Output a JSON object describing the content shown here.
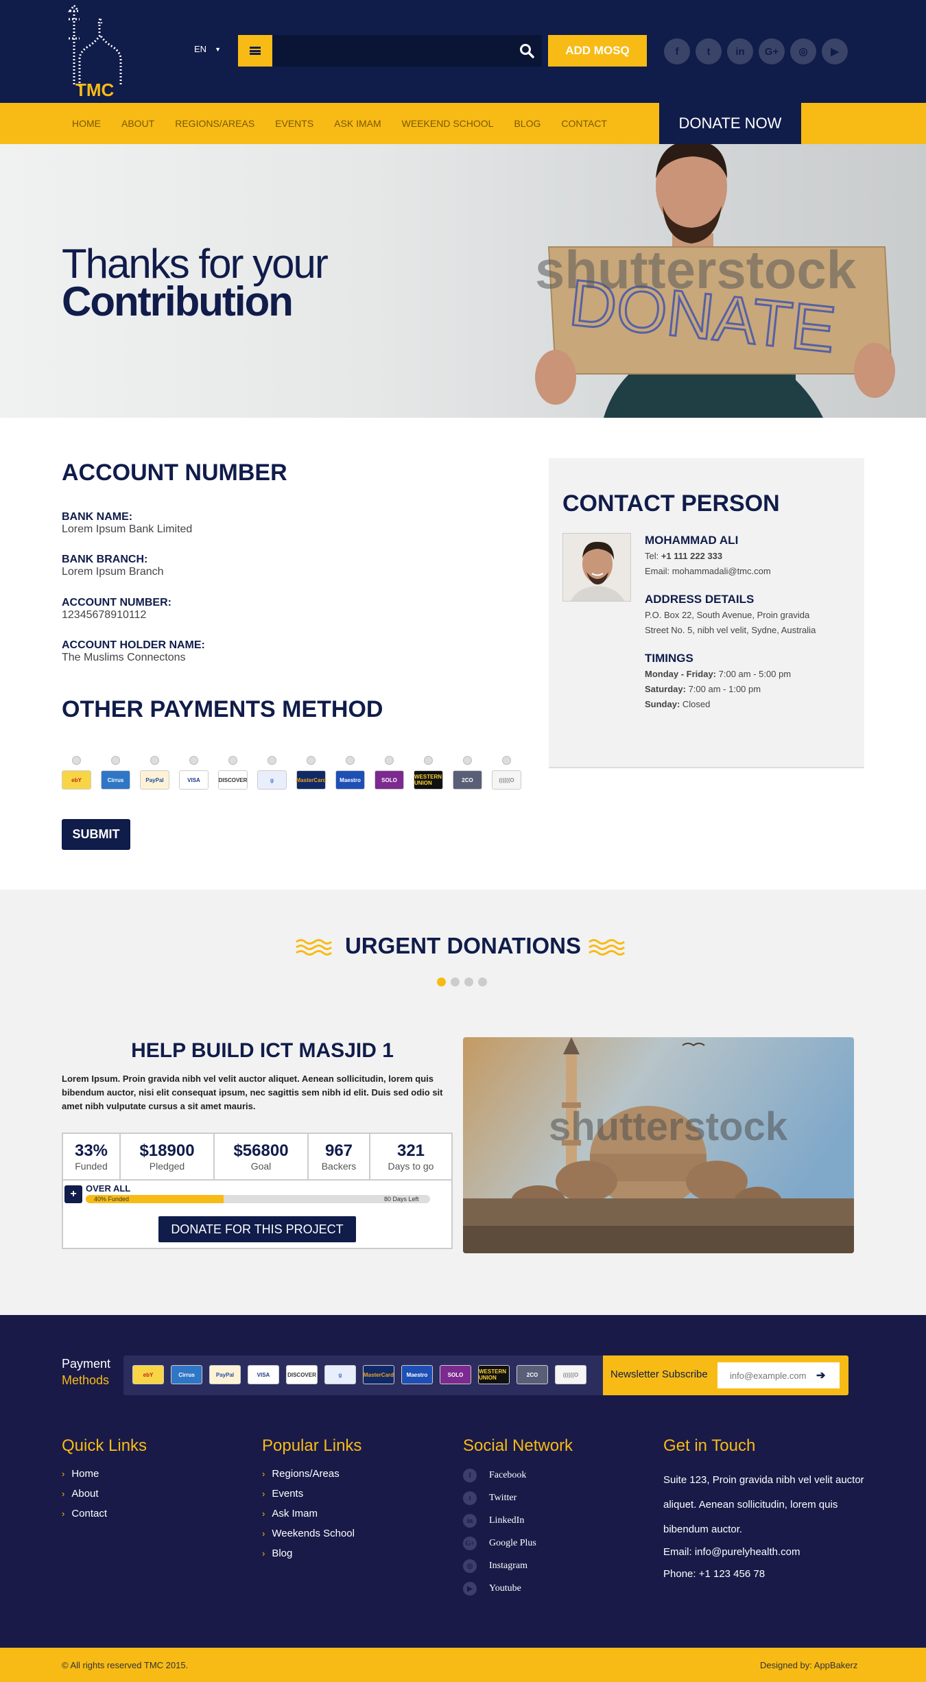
{
  "header": {
    "logo_text": "TMC",
    "language": "EN",
    "search_placeholder": "",
    "add_mosq": "ADD MOSQ",
    "social_icons": [
      "facebook-icon",
      "twitter-icon",
      "linkedin-icon",
      "google-plus-icon",
      "instagram-icon",
      "youtube-icon"
    ]
  },
  "nav": {
    "items": [
      "HOME",
      "ABOUT",
      "REGIONS/AREAS",
      "EVENTS",
      "ASK IMAM",
      "WEEKEND SCHOOL",
      "BLOG",
      "CONTACT"
    ],
    "donate_now": "DONATE NOW"
  },
  "hero": {
    "line1": "Thanks for your",
    "line2": "Contribution",
    "sign_text": "DONATE"
  },
  "account": {
    "title": "ACCOUNT NUMBER",
    "fields": [
      {
        "label": "BANK NAME:",
        "value": "Lorem Ipsum Bank Limited"
      },
      {
        "label": "BANK BRANCH:",
        "value": "Lorem Ipsum Branch"
      },
      {
        "label": "ACCOUNT NUMBER:",
        "value": "12345678910112"
      },
      {
        "label": "ACCOUNT HOLDER NAME:",
        "value": "The Muslims Connectons"
      }
    ]
  },
  "payments": {
    "title": "OTHER PAYMENTS METHOD",
    "methods": [
      {
        "label": "ebY",
        "bg": "#f8d545",
        "fg": "#c0271d"
      },
      {
        "label": "Cirrus",
        "bg": "#2f76c6",
        "fg": "#ffffff"
      },
      {
        "label": "PayPal",
        "bg": "#fdf2d6",
        "fg": "#1f4d9e"
      },
      {
        "label": "VISA",
        "bg": "#ffffff",
        "fg": "#1a3a87"
      },
      {
        "label": "DISCOVER",
        "bg": "#ffffff",
        "fg": "#333333"
      },
      {
        "label": "g",
        "bg": "#e8eefb",
        "fg": "#3a6bc9"
      },
      {
        "label": "MasterCard",
        "bg": "#0f2a66",
        "fg": "#f6a021"
      },
      {
        "label": "Maestro",
        "bg": "#1e4fb5",
        "fg": "#ffffff"
      },
      {
        "label": "SOLO",
        "bg": "#7c2a8f",
        "fg": "#ffffff"
      },
      {
        "label": "WESTERN UNION",
        "bg": "#111111",
        "fg": "#f8d133"
      },
      {
        "label": "2CO",
        "bg": "#5a5f78",
        "fg": "#ffffff"
      },
      {
        "label": "((((((O",
        "bg": "#f5f5f5",
        "fg": "#888888"
      }
    ],
    "submit": "SUBMIT"
  },
  "contact": {
    "title": "CONTACT PERSON",
    "name": "MOHAMMAD ALI",
    "tel_label": "Tel: ",
    "tel": "+1 111 222 333",
    "email": "Email: mohammadali@tmc.com",
    "address_title": "ADDRESS DETAILS",
    "address1": "P.O. Box 22, South Avenue, Proin gravida",
    "address2": "Street No. 5, nibh vel velit, Sydne, Australia",
    "timings_title": "TIMINGS",
    "timings": [
      {
        "day": "Monday - Friday:",
        "time": " 7:00 am - 5:00 pm"
      },
      {
        "day": "Saturday:",
        "time": " 7:00 am - 1:00 pm"
      },
      {
        "day": "Sunday:",
        "time": " Closed"
      }
    ]
  },
  "urgent": {
    "title": "URGENT DONATIONS",
    "slide_count": 4,
    "active_slide": 1,
    "project_title": "HELP BUILD ICT MASJID 1",
    "description": "Lorem Ipsum. Proin gravida nibh vel velit auctor aliquet. Aenean sollicitudin, lorem quis bibendum auctor, nisi elit consequat ipsum, nec sagittis sem nibh id elit. Duis sed odio sit amet nibh vulputate cursus a sit amet mauris.",
    "stats": [
      {
        "num": "33%",
        "label": "Funded"
      },
      {
        "num": "$18900",
        "label": "Pledged"
      },
      {
        "num": "$56800",
        "label": "Goal"
      },
      {
        "num": "967",
        "label": "Backers"
      },
      {
        "num": "321",
        "label": "Days to go"
      }
    ],
    "overall": "OVER ALL",
    "progress_fraction": 0.4,
    "progress_text": "40% Funded",
    "days_left": "80 Days Left",
    "donate_button": "DONATE FOR THIS PROJECT",
    "watermark": "shutterstock"
  },
  "footer": {
    "payment_title_1": "Payment",
    "payment_title_2": "Methods",
    "newsletter_label": "Newsletter Subscribe",
    "newsletter_placeholder": "info@example.com",
    "quick_links_title": "Quick Links",
    "quick_links": [
      "Home",
      "About",
      "Contact"
    ],
    "popular_links_title": "Popular Links",
    "popular_links": [
      "Regions/Areas",
      "Events",
      "Ask Imam",
      "Weekends School",
      "Blog"
    ],
    "social_title": "Social Network",
    "social": [
      "Facebook",
      "Twitter",
      "LinkedIn",
      "Google Plus",
      "Instagram",
      "Youtube"
    ],
    "touch_title": "Get in Touch",
    "touch_text": "Suite 123, Proin gravida nibh vel velit auctor aliquet. Aenean sollicitudin, lorem quis bibendum auctor.",
    "touch_email": "Email: info@purelyhealth.com",
    "touch_phone": "Phone: +1 123 456 78",
    "copyright": "© All rights reserved TMC 2015.",
    "designed_by": "Designed by: AppBakerz"
  },
  "colors": {
    "navy": "#101c4a",
    "yellow": "#f8bb15",
    "footer": "#191a48"
  }
}
